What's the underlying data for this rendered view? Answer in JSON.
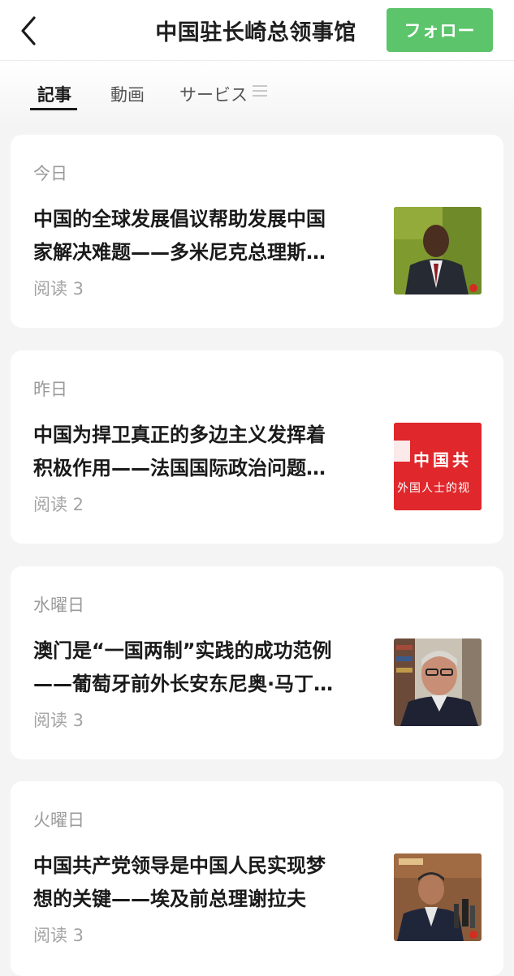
{
  "header": {
    "title": "中国驻长崎总领事馆",
    "follow_label": "フォロー"
  },
  "tabs": [
    {
      "label": "記事"
    },
    {
      "label": "動画"
    },
    {
      "label": "サービス"
    }
  ],
  "articles": [
    {
      "day": "今日",
      "title_line1": "中国的全球发展倡议帮助发展中国",
      "title_line2": "家解决难题——多米尼克总理斯…",
      "reads": "阅读 3"
    },
    {
      "day": "昨日",
      "title_line1": "中国为捍卫真正的多边主义发挥着",
      "title_line2": "积极作用——法国国际政治问题…",
      "reads": "阅读 2",
      "thumb_text_top": "中国共",
      "thumb_text_bottom": "外国人士的视"
    },
    {
      "day": "水曜日",
      "title_line1": "澳门是“一国两制”实践的成功范例",
      "title_line2": "——葡萄牙前外长安东尼奥·马丁…",
      "reads": "阅读 3"
    },
    {
      "day": "火曜日",
      "title_line1": "中国共产党领导是中国人民实现梦",
      "title_line2": "想的关键——埃及前总理谢拉夫",
      "reads": "阅读 3"
    }
  ],
  "colors": {
    "accent_green": "#5cc46b",
    "background": "#f4f4f4",
    "thumb_red": "#e0272b"
  }
}
